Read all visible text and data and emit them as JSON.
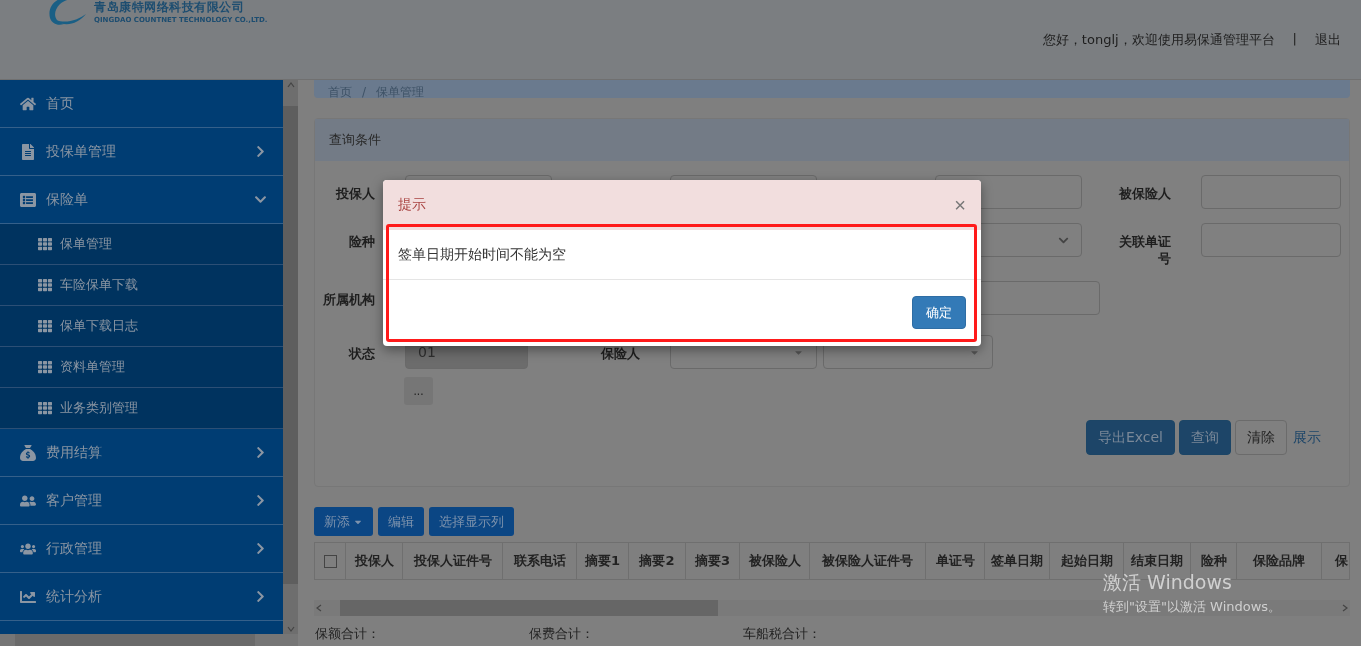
{
  "header": {
    "company": "青岛康特网络科技有限公司",
    "company_en": "QINGDAO COUNTNET TECHNOLOGY CO.,LTD.",
    "greeting": "您好，tonglj，欢迎使用易保通管理平台",
    "separator": "|",
    "logout": "退出"
  },
  "sidebar": {
    "items": [
      {
        "label": "首页",
        "kind": "link"
      },
      {
        "label": "投保单管理",
        "kind": "group",
        "expanded": false
      },
      {
        "label": "保险单",
        "kind": "group",
        "expanded": true,
        "children": [
          {
            "label": "保单管理"
          },
          {
            "label": "车险保单下载"
          },
          {
            "label": "保单下载日志"
          },
          {
            "label": "资料单管理"
          },
          {
            "label": "业务类别管理"
          }
        ]
      },
      {
        "label": "费用结算",
        "kind": "group",
        "expanded": false
      },
      {
        "label": "客户管理",
        "kind": "group",
        "expanded": false
      },
      {
        "label": "行政管理",
        "kind": "group",
        "expanded": false
      },
      {
        "label": "统计分析",
        "kind": "group",
        "expanded": false
      }
    ]
  },
  "breadcrumb": {
    "items": [
      "首页",
      "保单管理"
    ],
    "separator": "/"
  },
  "form": {
    "title": "查询条件",
    "rows": [
      [
        {
          "label": "投保人",
          "kind": "text"
        },
        {
          "kind": "text"
        },
        {
          "kind": "text"
        },
        {
          "label": "被保险人",
          "kind": "text"
        }
      ],
      [
        {
          "label": "险种"
        },
        {
          "kind": "select"
        },
        {
          "label": "关联单证号",
          "kind": "text"
        }
      ],
      [
        {
          "label": "所属机构"
        },
        {
          "kind": "text"
        }
      ],
      [
        {
          "label": "状态",
          "kind": "text",
          "value": "01",
          "disabled": true
        },
        {
          "label": "保险人",
          "kind": "dropdown"
        },
        {
          "kind": "dropdown"
        }
      ]
    ],
    "more_button": "...",
    "buttons": [
      {
        "label": "导出Excel",
        "kind": "primary"
      },
      {
        "label": "查询",
        "kind": "primary"
      },
      {
        "label": "清除",
        "kind": "default"
      }
    ],
    "toggle_link": "展示"
  },
  "toolbar": [
    {
      "label": "新添",
      "caret": true
    },
    {
      "label": "编辑",
      "caret": false
    },
    {
      "label": "选择显示列",
      "caret": false
    }
  ],
  "table": {
    "select_all": {
      "checked": false
    },
    "columns": [
      "投保人",
      "投保人证件号",
      "联系电话",
      "摘要1",
      "摘要2",
      "摘要3",
      "被保险人",
      "被保险人证件号",
      "单证号",
      "签单日期",
      "起始日期",
      "结束日期",
      "险种",
      "保险品牌",
      "保"
    ]
  },
  "totals": [
    "保额合计：",
    "保费合计：",
    "车船税合计："
  ],
  "modal": {
    "title": "提示",
    "close": "×",
    "message": "签单日期开始时间不能为空",
    "ok": "确定"
  },
  "os_notice": {
    "title": "激活 Windows",
    "text": "转到\"设置\"以激活 Windows。"
  }
}
